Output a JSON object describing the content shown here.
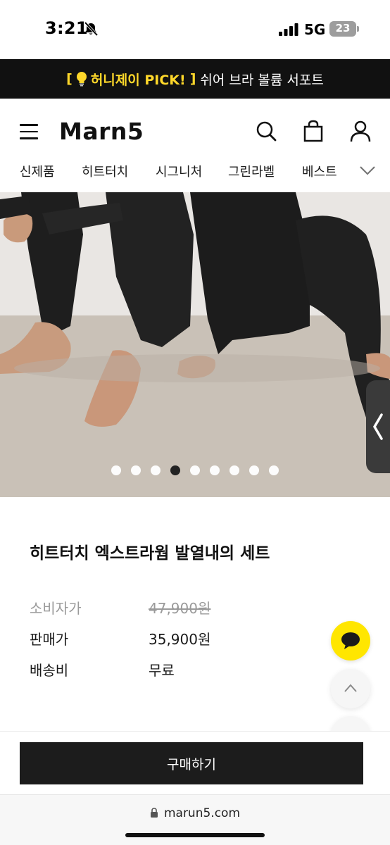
{
  "status_bar": {
    "time": "3:21",
    "network": "5G",
    "battery": "23"
  },
  "promo": {
    "open_bracket": "[",
    "highlight": "허니제이 PICK!",
    "close_bracket": "]",
    "text": "쉬어 브라 볼륨 서포트"
  },
  "header": {
    "logo": "Marn5"
  },
  "nav": {
    "items": [
      "신제품",
      "히트터치",
      "시그니처",
      "그린라벨",
      "베스트"
    ]
  },
  "carousel": {
    "total": 9,
    "active_index": 3
  },
  "product": {
    "title": "히트터치 엑스트라웜 발열내의 세트",
    "list_price_label": "소비자가",
    "list_price": "47,900원",
    "sale_price_label": "판매가",
    "sale_price": "35,900원",
    "shipping_label": "배송비",
    "shipping": "무료"
  },
  "buy": {
    "label": "구매하기"
  },
  "browser": {
    "url": "marun5.com"
  },
  "colors": {
    "promo_bg": "#111111",
    "promo_highlight": "#ffd82a",
    "chat_fab": "#ffe600",
    "buy_button": "#1c1c1c"
  }
}
